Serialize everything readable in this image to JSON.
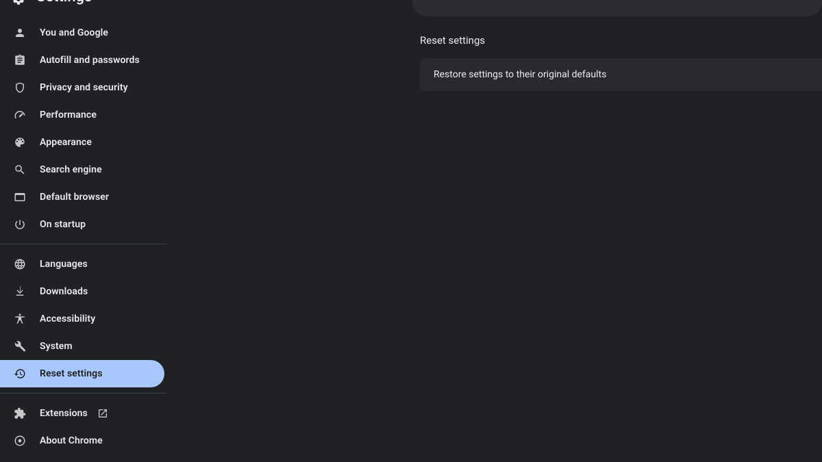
{
  "header": {
    "title": "Settings"
  },
  "sidebar": {
    "items": [
      {
        "label": "You and Google"
      },
      {
        "label": "Autofill and passwords"
      },
      {
        "label": "Privacy and security"
      },
      {
        "label": "Performance"
      },
      {
        "label": "Appearance"
      },
      {
        "label": "Search engine"
      },
      {
        "label": "Default browser"
      },
      {
        "label": "On startup"
      },
      {
        "label": "Languages"
      },
      {
        "label": "Downloads"
      },
      {
        "label": "Accessibility"
      },
      {
        "label": "System"
      },
      {
        "label": "Reset settings"
      },
      {
        "label": "Extensions"
      },
      {
        "label": "About Chrome"
      }
    ]
  },
  "main": {
    "section_title": "Reset settings",
    "row1": "Restore settings to their original defaults"
  }
}
